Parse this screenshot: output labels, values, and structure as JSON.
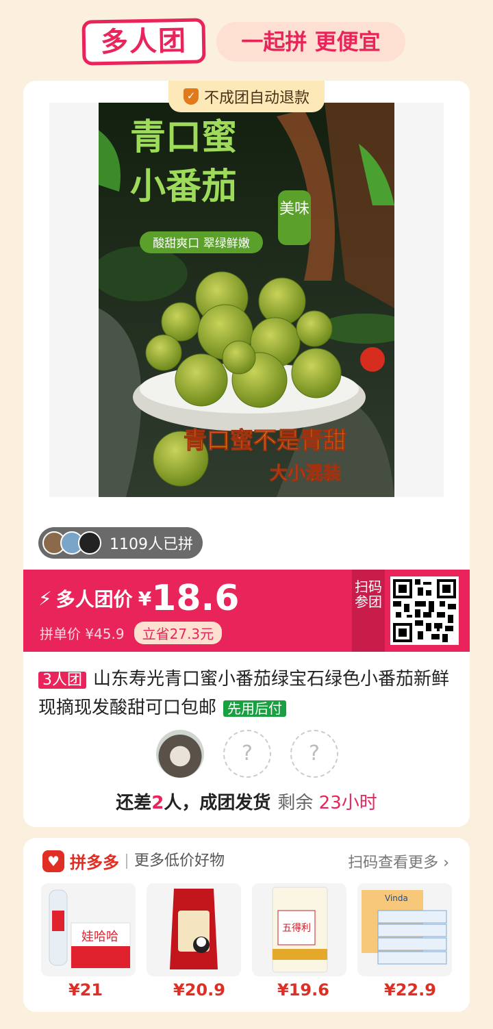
{
  "header": {
    "logo": "多人团",
    "slogan": "一起拼 更便宜"
  },
  "badge": {
    "refund": "不成团自动退款"
  },
  "product_image": {
    "title1": "青口蜜",
    "title2": "小番茄",
    "bubble": "美味",
    "features": "酸甜爽口 翠绿鲜嫩",
    "slogan": "青口蜜不是青甜",
    "mix": "大小混装"
  },
  "joined": {
    "count_text": "1109人已拼"
  },
  "price": {
    "group_label": "多人团价",
    "currency": "¥",
    "group_price": "18.6",
    "single_label": "拼单价 ¥45.9",
    "save": "立省27.3元",
    "scan": "扫码参团"
  },
  "title": {
    "tag": "3人团",
    "text": "山东寿光青口蜜小番茄绿宝石绿色小番茄新鲜现摘现发酸甜可口包邮",
    "pay_tag": "先用后付"
  },
  "group": {
    "need_prefix": "还差",
    "need_num": "2",
    "need_suffix": "人，成团发货",
    "remain_label": "剩余",
    "remain_time": "23小时",
    "placeholder": "?"
  },
  "recommend": {
    "brand": "拼多多",
    "subtitle": "更多低价好物",
    "more": "扫码查看更多",
    "products": [
      {
        "name": "娃哈哈",
        "price": "¥21"
      },
      {
        "name": "五得利",
        "price": "¥19.6"
      },
      {
        "name": "Vinda",
        "price": "¥22.9"
      },
      {
        "price": "¥20.9"
      }
    ]
  }
}
